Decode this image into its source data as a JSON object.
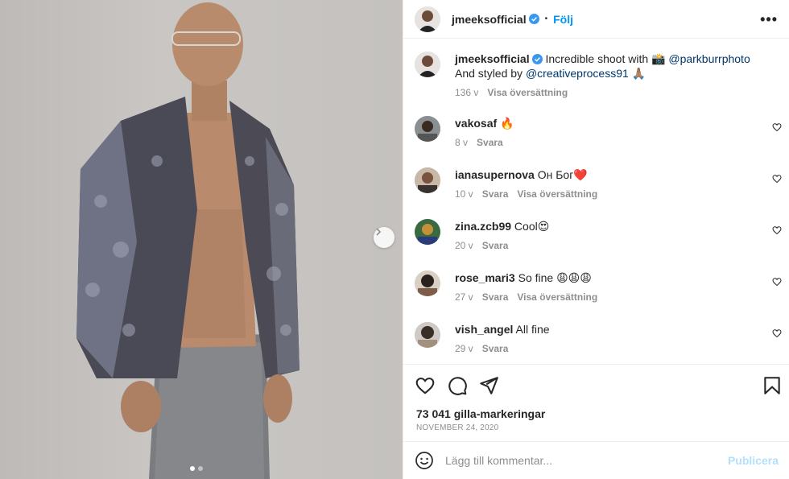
{
  "post": {
    "author": "jmeeksofficial",
    "follow_label": "Följ",
    "separator": "•",
    "more_label": "•••"
  },
  "caption": {
    "username": "jmeeksofficial",
    "text_1": "Incredible shoot with",
    "camera_emoji": "📸",
    "mention_1": "@parkburrphoto",
    "text_2": "And styled by",
    "mention_2": "@creativeprocess91",
    "pray_emoji": "🙏🏽",
    "time": "136 v",
    "translate": "Visa översättning"
  },
  "comments": [
    {
      "username": "vakosaf",
      "text": "🔥",
      "time": "8 v",
      "reply": "Svara",
      "translate": ""
    },
    {
      "username": "ianasupernova",
      "text": "Он Бог❤️",
      "time": "10 v",
      "reply": "Svara",
      "translate": "Visa översättning"
    },
    {
      "username": "zina.zcb99",
      "text": "Cool😍",
      "time": "20 v",
      "reply": "Svara",
      "translate": ""
    },
    {
      "username": "rose_mari3",
      "text": "So fine 😩😩😩",
      "time": "27 v",
      "reply": "Svara",
      "translate": "Visa översättning"
    },
    {
      "username": "vish_angel",
      "text": "All fine",
      "time": "29 v",
      "reply": "Svara",
      "translate": ""
    }
  ],
  "actions": {
    "likes": "73 041 gilla-markeringar",
    "date": "NOVEMBER 24, 2020"
  },
  "composer": {
    "placeholder": "Lägg till kommentar...",
    "publish_label": "Publicera"
  },
  "carousel": {
    "current": 1,
    "total": 2
  },
  "icons": {
    "verified": "verified-badge-icon",
    "heart": "heart-icon",
    "comment": "comment-icon",
    "share": "share-icon",
    "save": "bookmark-icon",
    "emoji": "emoji-icon",
    "next": "chevron-right-icon"
  },
  "colors": {
    "link_blue": "#0095f6",
    "mention": "#00376b",
    "secondary_text": "#8e8e8e",
    "publish_disabled": "#b2dffc"
  }
}
